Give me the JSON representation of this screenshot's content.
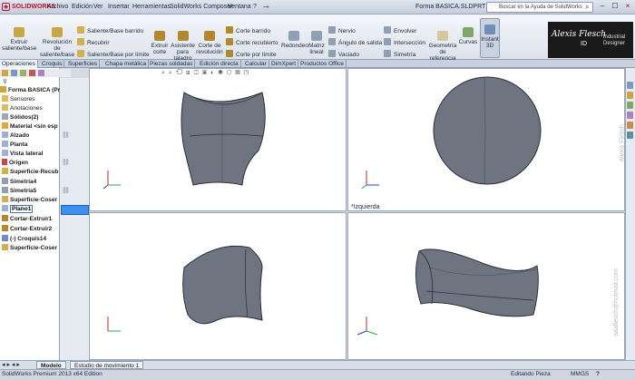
{
  "app": {
    "logo": "SOLIDWORKS",
    "doc_title": "Forma BASICA.SLDPRT"
  },
  "menu": [
    "Archivo",
    "Edición",
    "Ver",
    "Insertar",
    "Herramientas",
    "SolidWorks Composer",
    "Ventana",
    "?"
  ],
  "search": {
    "placeholder": "Buscar en la Ayuda de SolidWorks"
  },
  "window_buttons": [
    "–",
    "☐",
    "×"
  ],
  "commands": {
    "big": [
      "Extruir saliente/base",
      "Revolución de saliente/base",
      "Extruir corte",
      "Asistente para taladro",
      "Corte de revolución",
      "Redondeo",
      "Matriz lineal",
      "Geometría de referencia",
      "Curvas",
      "Instant 3D"
    ],
    "col1": [
      "Saliente/Base barrido",
      "Recubrir",
      "Saliente/Base por límite"
    ],
    "col2": [
      "Corte barrido",
      "Corte recubierto",
      "Corte por límite"
    ],
    "col3": [
      "Nervio",
      "Ángulo de salida",
      "Vaciado"
    ],
    "col4": [
      "Envolver",
      "Intersección",
      "Simetría"
    ]
  },
  "brand": {
    "name": "Alexis Flesch",
    "tag": "ID",
    "sub": "Industrial Designer"
  },
  "tabs": [
    "Operaciones",
    "Croquis",
    "Superficies",
    "Chapa metálica",
    "Piezas soldadas",
    "Edición directa",
    "Calcular",
    "DimXpert",
    "Productos Office"
  ],
  "tree": {
    "root": "Forma BASICA  (Pre",
    "items": [
      "Sensores",
      "Anotaciones",
      "Sólidos(2)",
      "Material <sin esp",
      "Alzado",
      "Planta",
      "Vista lateral",
      "Origen",
      "Superficie-Recub",
      "Simetría4",
      "Simetría5",
      "Superficie-Coser",
      "Plano1",
      "Cortar-Extruir1",
      "Cortar-Extruir2",
      "(-) Croquis14",
      "Superficie-Coser"
    ],
    "selected_index": 12
  },
  "viewports": {
    "top_right_label": "*Izquierda"
  },
  "watermarks": [
    "Alexis Flesch",
    "aaaflesch@hotmail.com"
  ],
  "bottom_tabs": [
    "Modelo",
    "Estudio de movimiento 1"
  ],
  "status": {
    "edition": "SolidWorks Premium 2013 x64 Edition",
    "mode": "Editando Pieza",
    "units": "MMGS",
    "help": "?"
  },
  "colors": {
    "model_fill": "#6e7580",
    "model_edge": "#2b2f35",
    "selection": "#3d8ff0",
    "accent": "#c8102e"
  }
}
